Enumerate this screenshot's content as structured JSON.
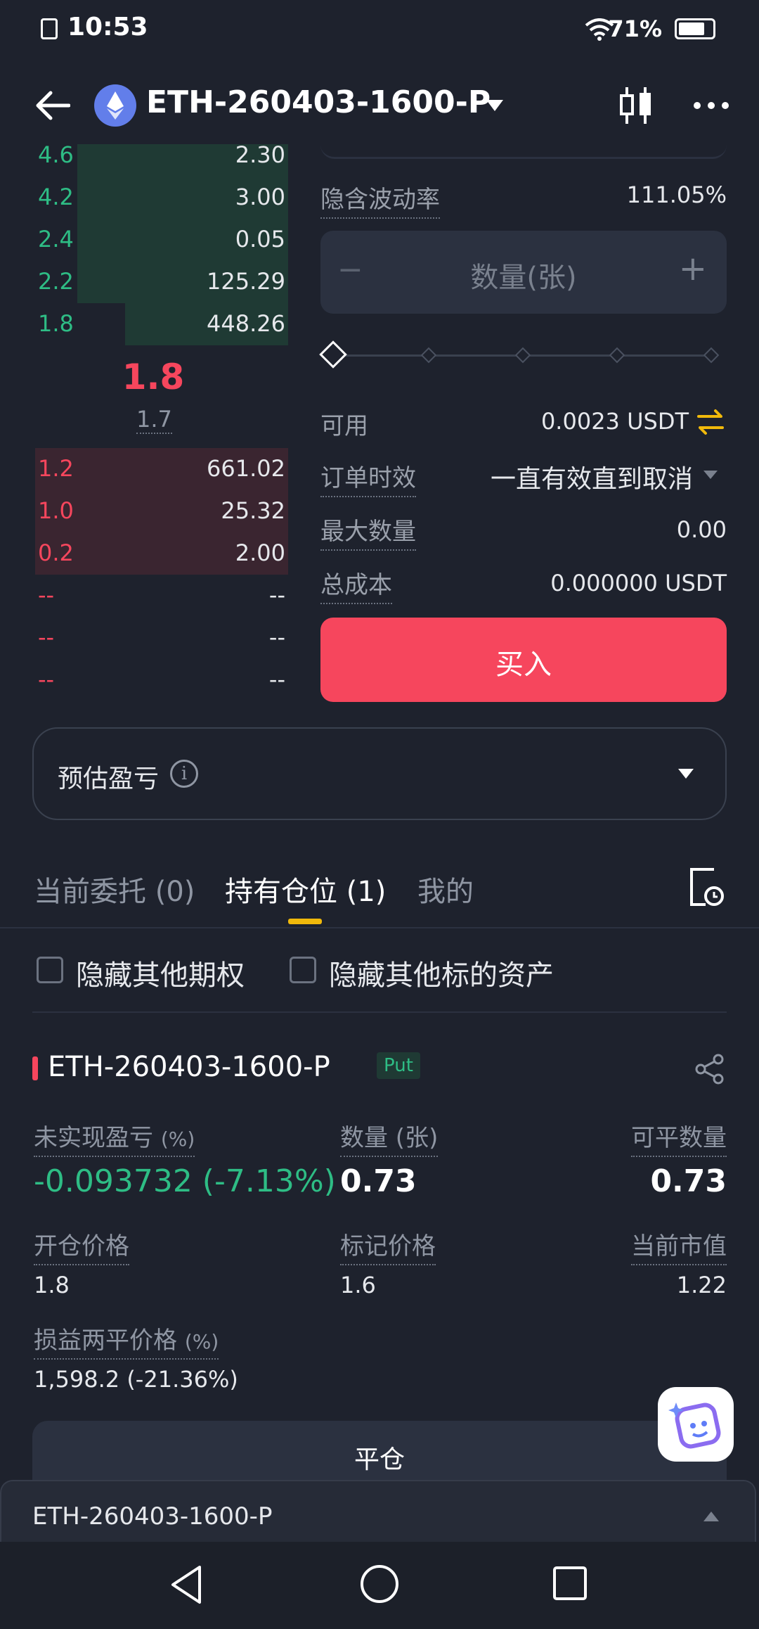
{
  "status_bar": {
    "time": "10:53",
    "battery": "71%"
  },
  "header": {
    "title": "ETH-260403-1600-P"
  },
  "orderbook": {
    "asks": [
      {
        "price": "4.6",
        "qty": "2.30"
      },
      {
        "price": "4.2",
        "qty": "3.00"
      },
      {
        "price": "2.4",
        "qty": "0.05"
      },
      {
        "price": "2.2",
        "qty": "125.29"
      },
      {
        "price": "1.8",
        "qty": "448.26"
      }
    ],
    "last_price": "1.8",
    "mark_price": "1.7",
    "bids": [
      {
        "price": "1.2",
        "qty": "661.02"
      },
      {
        "price": "1.0",
        "qty": "25.32"
      },
      {
        "price": "0.2",
        "qty": "2.00"
      },
      {
        "price": "--",
        "qty": "--"
      },
      {
        "price": "--",
        "qty": "--"
      },
      {
        "price": "--",
        "qty": "--"
      }
    ]
  },
  "form": {
    "iv_label": "隐含波动率",
    "iv_value": "111.05%",
    "qty_placeholder": "数量(张)",
    "minus": "−",
    "plus": "+",
    "available_label": "可用",
    "available_value": "0.0023 USDT",
    "tif_label": "订单时效",
    "tif_value": "一直有效直到取消",
    "maxqty_label": "最大数量",
    "maxqty_value": "0.00",
    "cost_label": "总成本",
    "cost_value": "0.000000 USDT",
    "buy_label": "买入"
  },
  "pnl_estimate": {
    "label": "预估盈亏"
  },
  "tabs": [
    {
      "label": "当前委托 (0)"
    },
    {
      "label": "持有仓位 (1)"
    },
    {
      "label": "我的"
    }
  ],
  "filters": {
    "hide_other_options": "隐藏其他期权",
    "hide_other_underlying": "隐藏其他标的资产"
  },
  "position": {
    "symbol": "ETH-260403-1600-P",
    "badge": "Put",
    "upnl_label": "未实现盈亏",
    "upnl_unit": "(%)",
    "upnl_value": "-0.093732 (-7.13%)",
    "qty_label": "数量 (张)",
    "qty_value": "0.73",
    "closable_label": "可平数量",
    "closable_value": "0.73",
    "entry_label": "开仓价格",
    "entry_value": "1.8",
    "mark_label": "标记价格",
    "mark_value": "1.6",
    "mv_label": "当前市值",
    "mv_value": "1.22",
    "be_label": "损益两平价格",
    "be_unit": "(%)",
    "be_value": "1,598.2 (-21.36%)",
    "close_label": "平仓"
  },
  "bottom_bar": {
    "symbol": "ETH-260403-1600-P"
  },
  "colors": {
    "green": "#2ebd85",
    "red": "#f6465d",
    "accent": "#f0b90b",
    "bg": "#1e222d"
  }
}
